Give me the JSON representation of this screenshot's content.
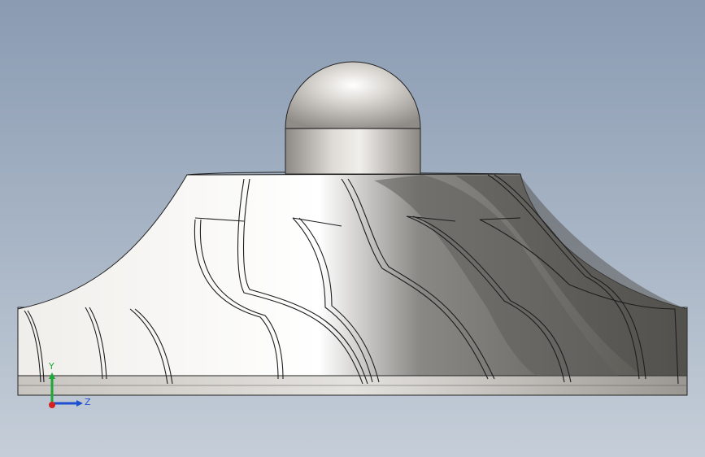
{
  "view": {
    "background_top": "#8a9bb2",
    "background_bottom": "#c5ced8"
  },
  "triad": {
    "y_label": "Y",
    "z_label": "Z",
    "y_color": "#1fa83a",
    "z_color": "#1f4fd1",
    "x_color": "#d42020"
  },
  "model": {
    "blade_count": 9,
    "material_light": "#e8e6e2",
    "material_dark": "#6a6966"
  }
}
